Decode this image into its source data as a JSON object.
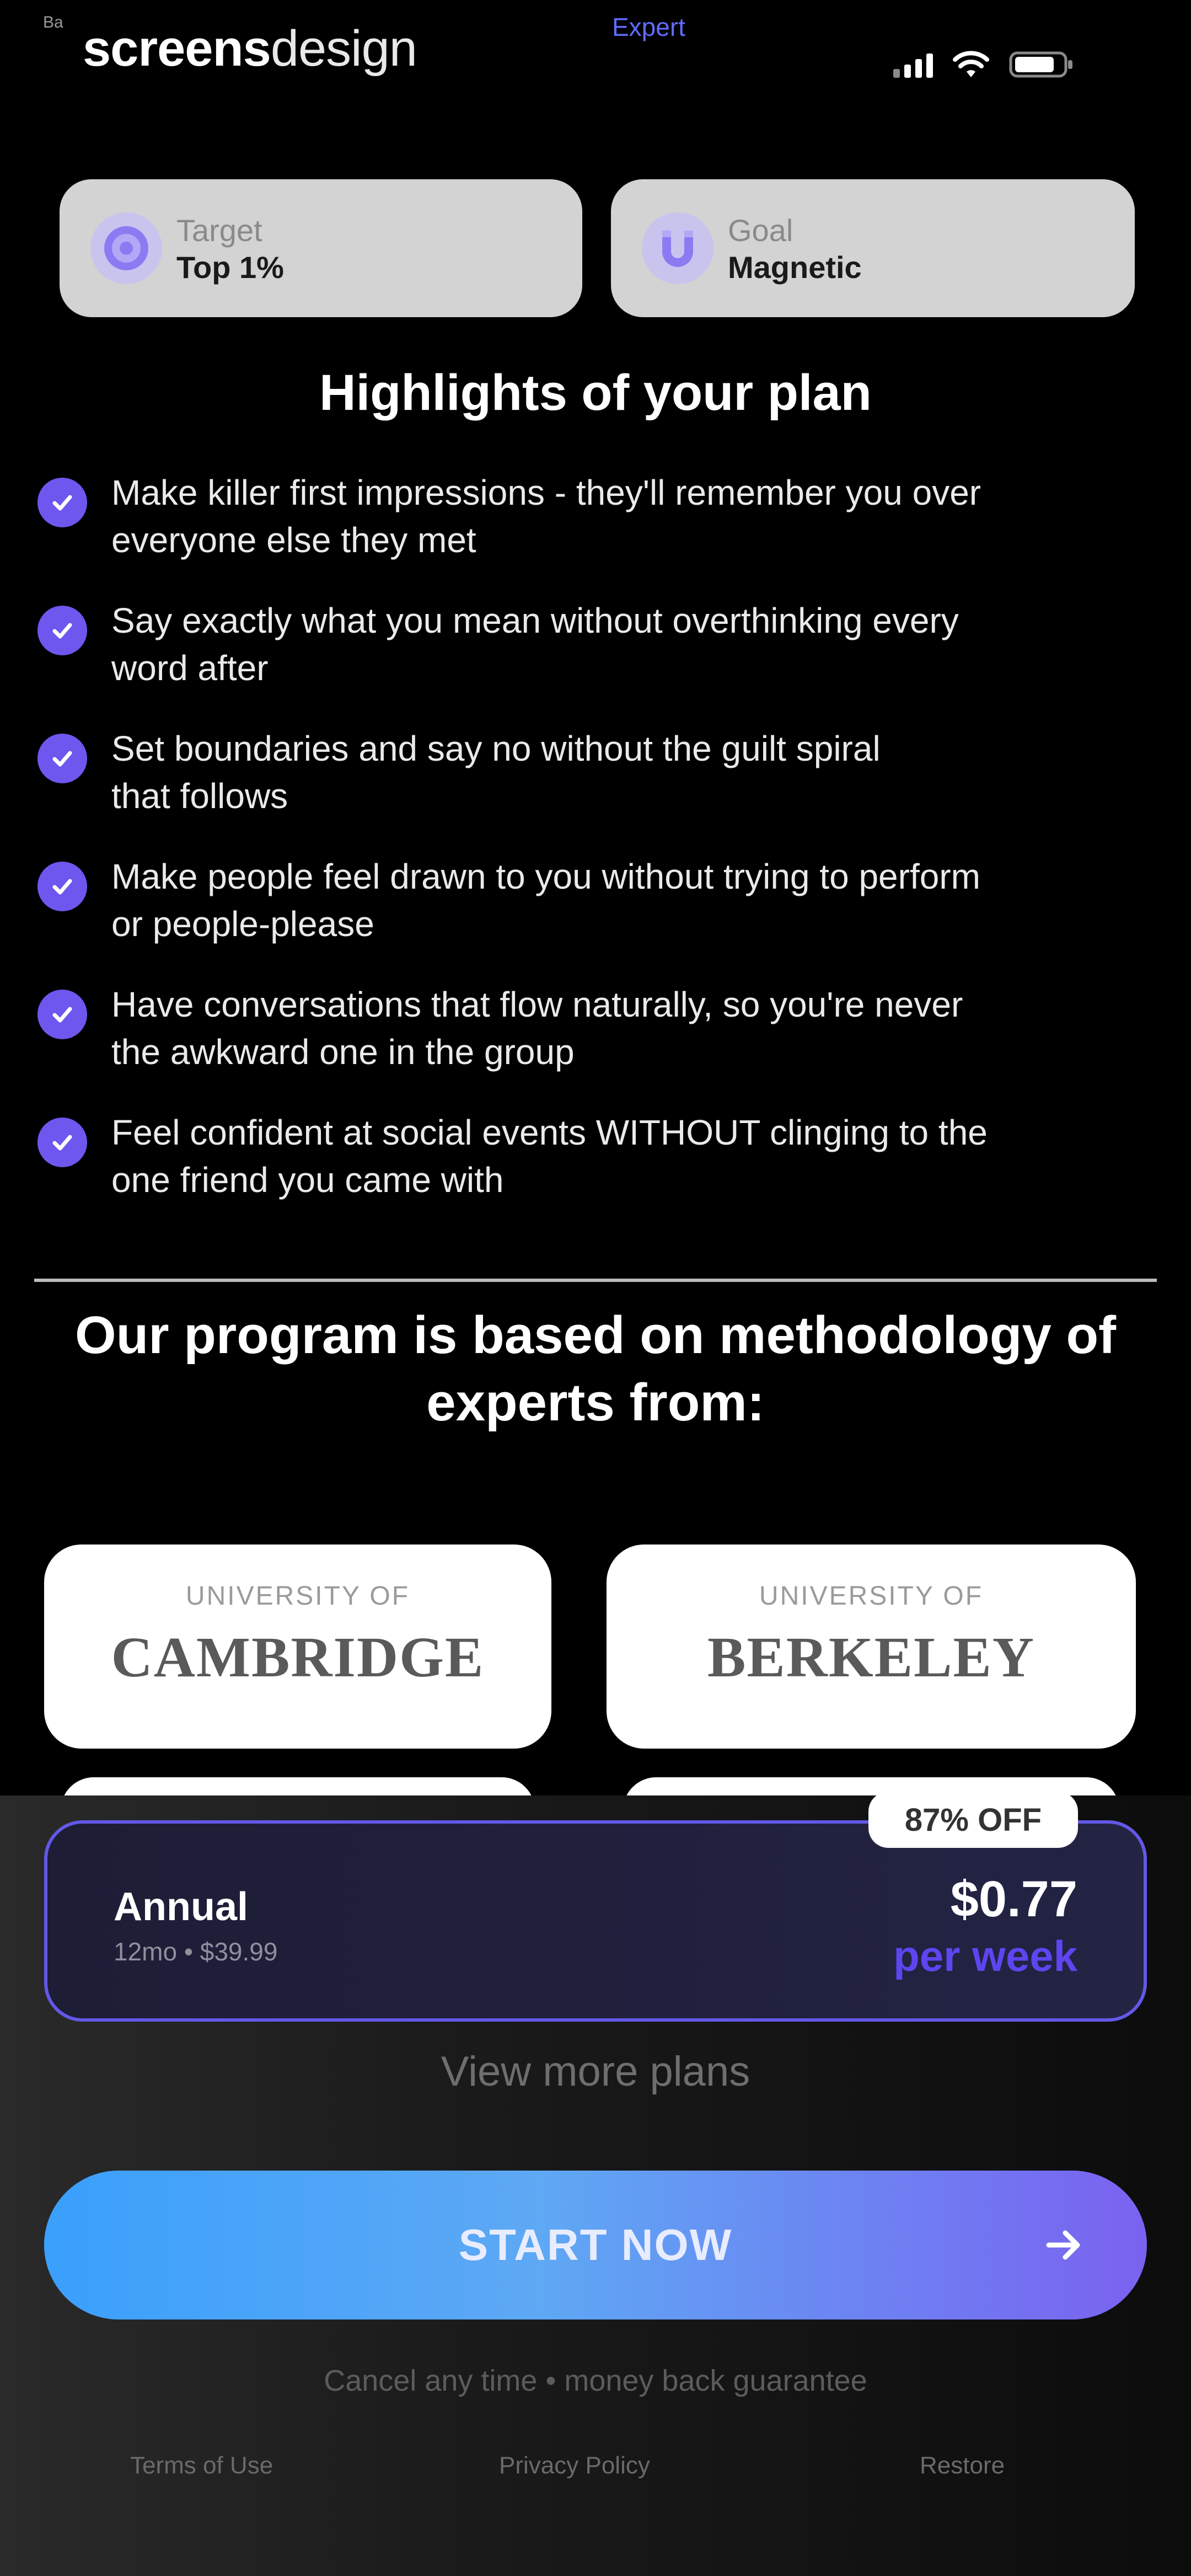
{
  "status_bar": {
    "tiny_label": "Ba",
    "brand_bold": "screens",
    "brand_light": "design",
    "center_label": "Expert"
  },
  "top_cards": [
    {
      "label": "Target",
      "value": "Top 1%",
      "icon": "target-icon"
    },
    {
      "label": "Goal",
      "value": "Magnetic",
      "icon": "magnet-icon"
    }
  ],
  "highlights": {
    "title": "Highlights of your plan",
    "items": [
      {
        "line1": "Make killer first impressions - they'll remember you over",
        "line2": "everyone else they met"
      },
      {
        "line1": "Say exactly what you mean without overthinking every",
        "line2": "word after"
      },
      {
        "line1": "Set boundaries and say no without the guilt spiral",
        "line2": "that follows"
      },
      {
        "line1": "Make people feel drawn to you without trying to perform",
        "line2": "or people-please"
      },
      {
        "line1": "Have conversations that flow naturally, so you're never",
        "line2": "the awkward one in the group"
      },
      {
        "line1": "Feel confident at social events WITHOUT clinging to the",
        "line2": "one friend you came with"
      }
    ]
  },
  "program": {
    "line1": "Our program is based on methodology of",
    "line2": "experts from:"
  },
  "universities": [
    {
      "prefix": "UNIVERSITY OF",
      "name": "CAMBRIDGE"
    },
    {
      "prefix": "UNIVERSITY OF",
      "name": "BERKELEY"
    }
  ],
  "plan": {
    "badge": "87% OFF",
    "name": "Annual",
    "sub": "12mo • $39.99",
    "price": "$0.77",
    "per": "per week"
  },
  "view_more": "View more plans",
  "cta": {
    "label": "START NOW"
  },
  "cancel_note": "Cancel any time • money back guarantee",
  "footer": {
    "terms": "Terms of Use",
    "privacy": "Privacy Policy",
    "restore": "Restore"
  },
  "colors": {
    "accent": "#6d57ef",
    "cta_start": "#3aa0fc",
    "cta_end": "#7a62f0",
    "plan_border": "#6358e6"
  }
}
